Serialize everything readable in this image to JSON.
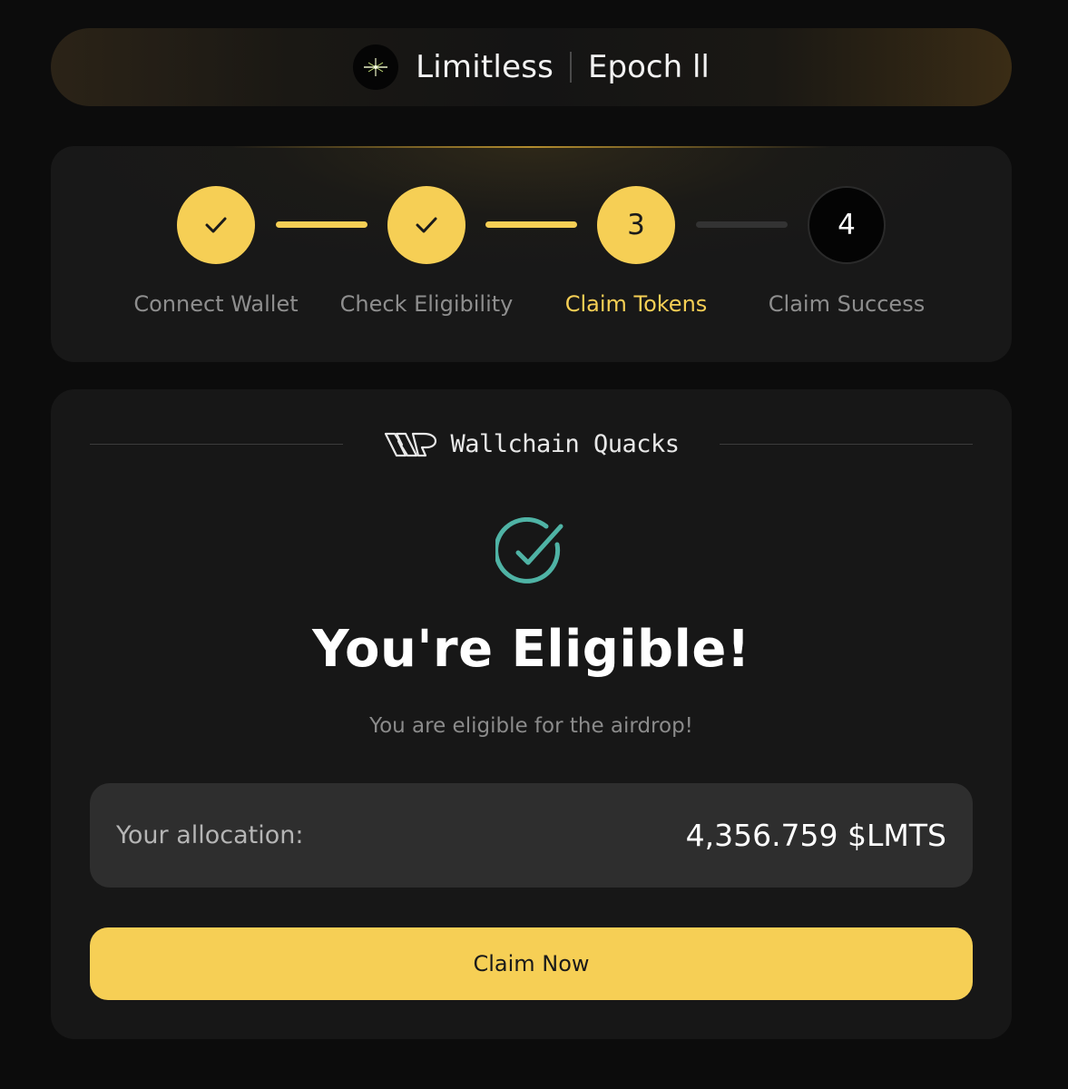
{
  "header": {
    "brand_name": "Limitless",
    "epoch_label": "Epoch ll"
  },
  "stepper": {
    "steps": [
      {
        "number": "1",
        "label": "Connect Wallet",
        "state": "done"
      },
      {
        "number": "2",
        "label": "Check Eligibility",
        "state": "done"
      },
      {
        "number": "3",
        "label": "Claim Tokens",
        "state": "active"
      },
      {
        "number": "4",
        "label": "Claim Success",
        "state": "pending"
      }
    ]
  },
  "main": {
    "partner_name": "Wallchain Quacks",
    "title": "You're Eligible!",
    "subtitle": "You are eligible for the airdrop!",
    "allocation_label": "Your allocation:",
    "allocation_value": "4,356.759 $LMTS",
    "claim_label": "Claim Now"
  },
  "icons": {
    "brand": "limitless-logo-icon",
    "step_done": "check-icon",
    "partner": "wallchain-logo-icon",
    "success": "check-circle-icon"
  },
  "colors": {
    "accent": "#f6cf55",
    "success": "#4fb3a5",
    "background": "#0c0c0c",
    "card": "#171717"
  }
}
